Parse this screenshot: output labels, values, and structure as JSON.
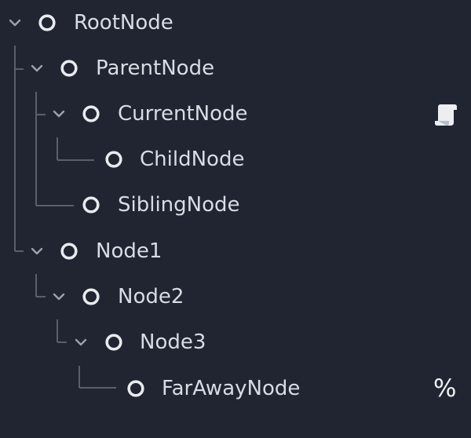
{
  "scene_tree": {
    "nodes": [
      {
        "label": "RootNode",
        "expanded": true
      },
      {
        "label": "ParentNode",
        "expanded": true
      },
      {
        "label": "CurrentNode",
        "expanded": true,
        "icon_right": "script-icon"
      },
      {
        "label": "ChildNode"
      },
      {
        "label": "SiblingNode"
      },
      {
        "label": "Node1",
        "expanded": true
      },
      {
        "label": "Node2",
        "expanded": true
      },
      {
        "label": "Node3",
        "expanded": true
      },
      {
        "label": "FarAwayNode",
        "badge": "%"
      }
    ]
  },
  "colors": {
    "background": "#202531",
    "text": "#d8dce4",
    "guide_lines": "#5a5f69",
    "chevron": "#9ca2ac",
    "node_icon": "#e8eaee"
  },
  "icons": {
    "expand": "chevron-down-icon",
    "node": "node-circle-icon",
    "script": "script-icon"
  }
}
